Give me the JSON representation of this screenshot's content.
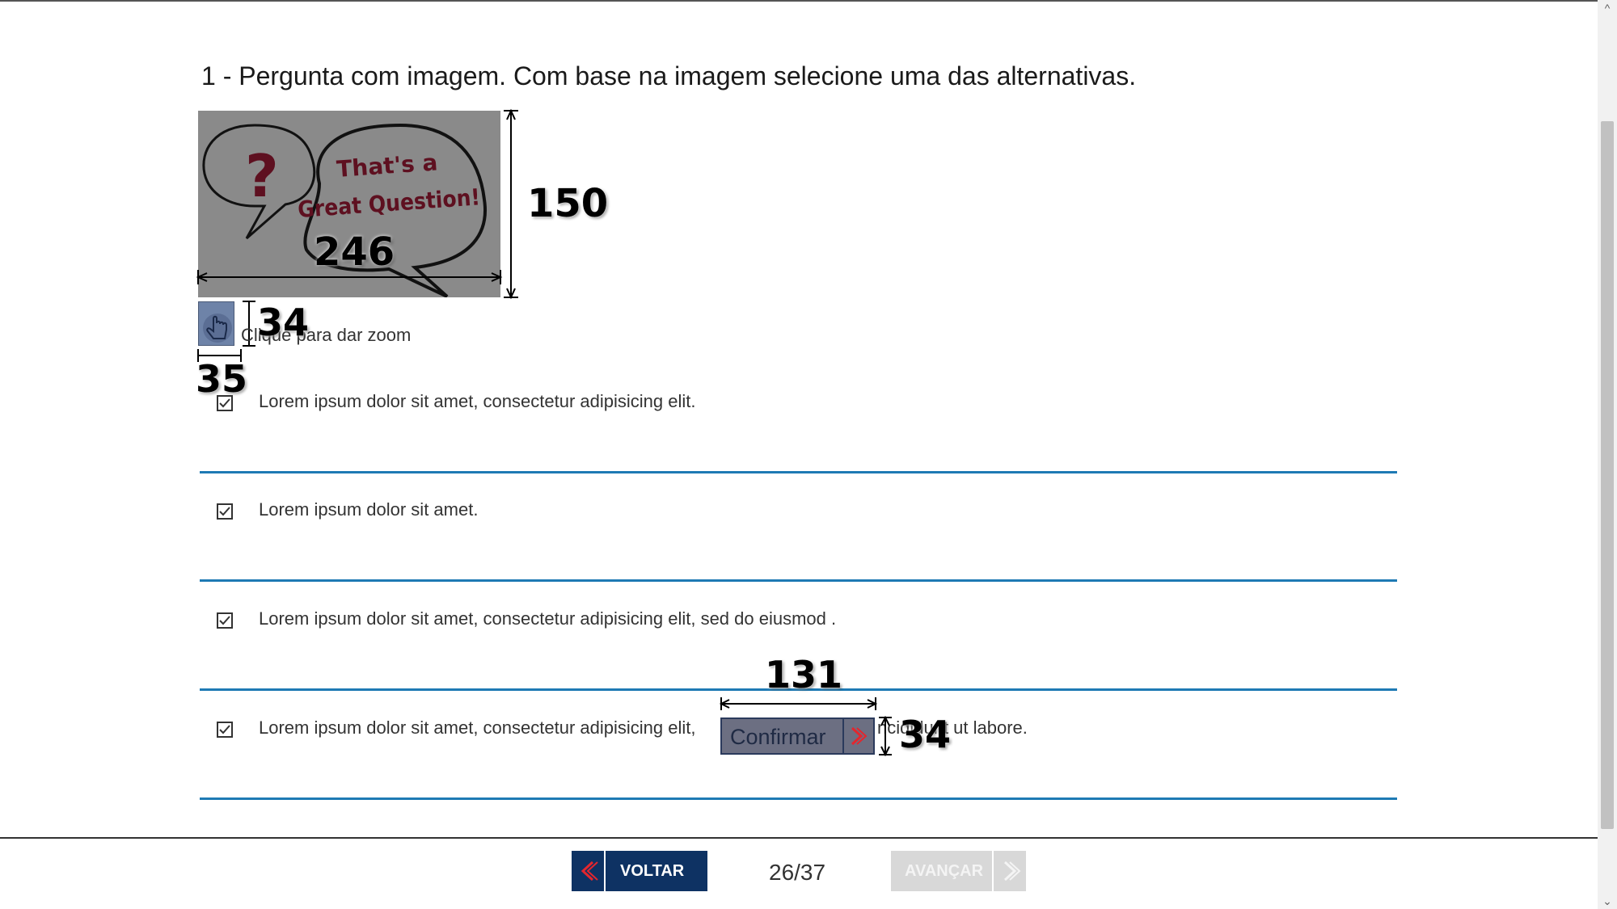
{
  "question": {
    "title": "1 - Pergunta com imagem. Com base na imagem selecione uma das alternativas.",
    "image": {
      "bubble_text_line1": "That's a",
      "bubble_text_line2": "Great Question!",
      "mark": "?"
    },
    "zoom_label": "Clique para dar zoom"
  },
  "annotations": {
    "image_width": "246",
    "image_height": "150",
    "zoom_height": "34",
    "zoom_width": "35",
    "confirm_width": "131",
    "confirm_height": "34"
  },
  "alternatives": [
    {
      "text": "Lorem ipsum dolor sit amet, consectetur adipisicing elit.",
      "checked": true
    },
    {
      "text": "Lorem ipsum dolor sit amet.",
      "checked": true
    },
    {
      "text": "Lorem ipsum dolor sit amet, consectetur adipisicing elit, sed do eiusmod .",
      "checked": true
    },
    {
      "text": "Lorem ipsum dolor sit amet, consectetur adipisicing elit,",
      "text_end": "ncididunt ut labore.",
      "checked": true
    }
  ],
  "confirm_button": {
    "label": "Confirmar"
  },
  "footer": {
    "back_label": "VOLTAR",
    "next_label": "AVANÇAR",
    "page_counter": "26/37"
  },
  "colors": {
    "accent_line": "#1e7ab4",
    "nav_primary": "#0e3263",
    "nav_arrow": "#e3262e",
    "nav_disabled": "#d8d8d8",
    "image_bg": "#8a8a8a",
    "bubble_text": "#7a1a2a"
  },
  "icons": {
    "zoom": "hand-pointer-icon",
    "checkbox": "checkbox-checked-icon",
    "back": "double-chevron-left-icon",
    "next": "double-chevron-right-icon",
    "confirm": "chevron-right-icon",
    "scroll_up": "chevron-up-icon",
    "scroll_down": "chevron-down-icon"
  }
}
